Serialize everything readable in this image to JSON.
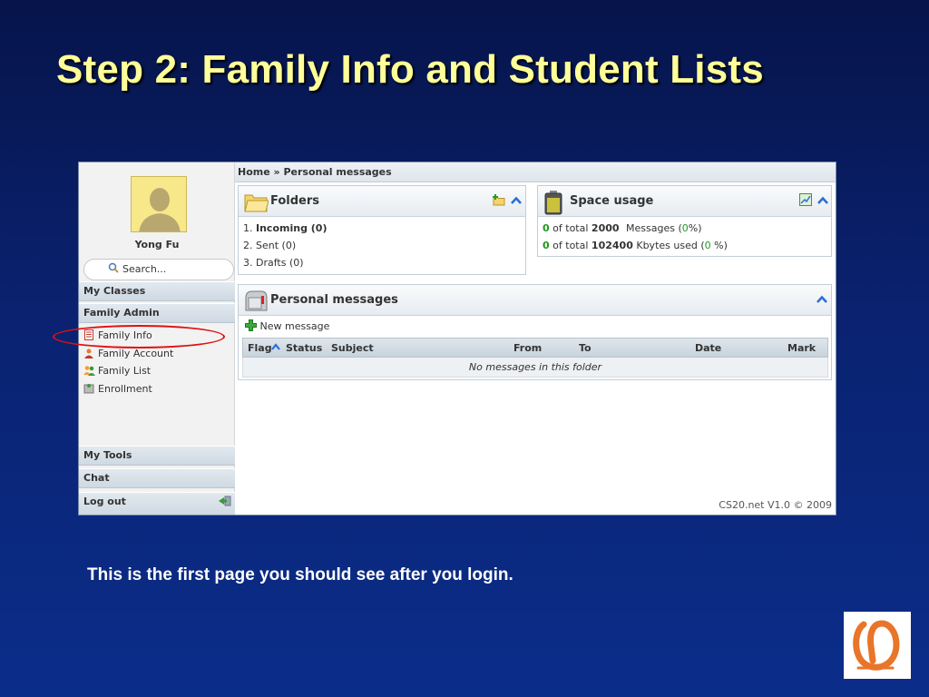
{
  "slide": {
    "title": "Step 2: Family Info and Student Lists",
    "caption": "This is the first page you should see after you login."
  },
  "sidebar": {
    "user_name": "Yong Fu",
    "search_placeholder": "Search...",
    "sections": {
      "my_classes": "My Classes",
      "family_admin": "Family Admin",
      "my_tools": "My Tools",
      "chat": "Chat",
      "log_out": "Log out"
    },
    "items": [
      {
        "label": "Family Info",
        "icon": "document-icon"
      },
      {
        "label": "Family Account",
        "icon": "account-icon"
      },
      {
        "label": "Family List",
        "icon": "users-icon"
      },
      {
        "label": "Enrollment",
        "icon": "enrollment-icon"
      }
    ]
  },
  "breadcrumb": "Home » Personal messages",
  "folders": {
    "title": "Folders",
    "items": [
      {
        "num": "1.",
        "label": "Incoming (0)"
      },
      {
        "num": "2.",
        "label": "Sent (0)"
      },
      {
        "num": "3.",
        "label": "Drafts (0)"
      }
    ]
  },
  "space_usage": {
    "title": "Space usage",
    "rows": [
      {
        "used": "0",
        "prefix": "of total",
        "total": "2000",
        "unit": "Messages (",
        "pct": "0",
        "suffix": "%)"
      },
      {
        "used": "0",
        "prefix": "of total",
        "total": "102400",
        "unit": "Kbytes used (",
        "pct": "0",
        "suffix": " %)"
      }
    ]
  },
  "personal_messages": {
    "title": "Personal messages",
    "new_message": "New message",
    "columns": [
      "Flag",
      "Status",
      "Subject",
      "From",
      "To",
      "Date",
      "Mark"
    ],
    "empty_text": "No messages in this folder"
  },
  "footer": "CS20.net V1.0 © 2009",
  "colors": {
    "slide_title": "#ffff99",
    "highlight": "#e01010",
    "count_green": "#1a9b1a",
    "chevron_blue": "#2a6fd6"
  }
}
